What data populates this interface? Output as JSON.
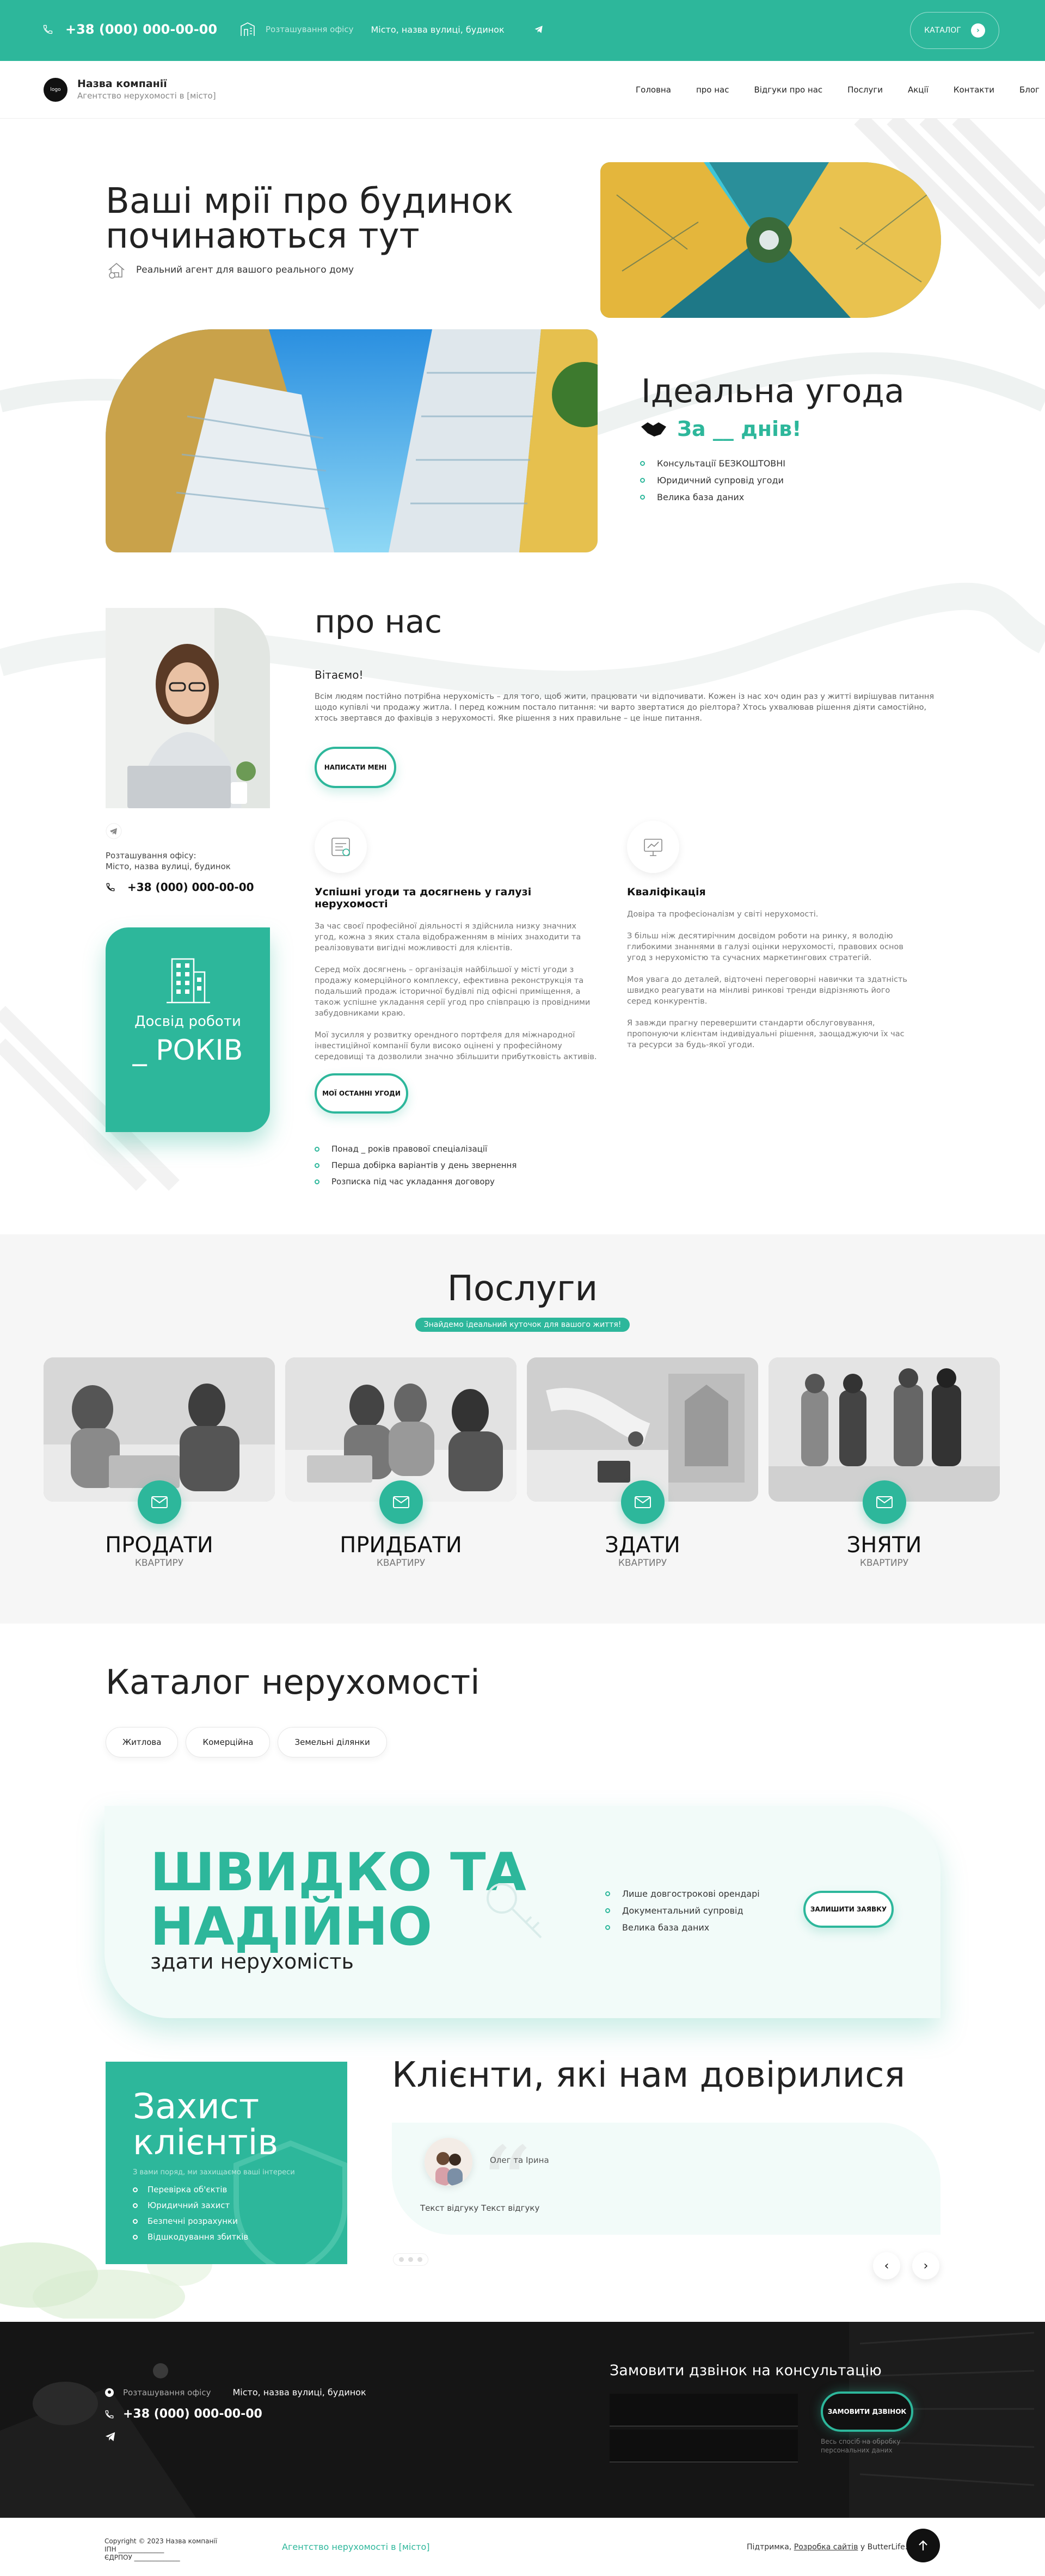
{
  "topbar": {
    "phone": "+38 (000) 000-00-00",
    "office_label": "Розташування офісу",
    "office_address": "Місто, назва вулиці, будинок",
    "catalog_label": "КАТАЛОГ"
  },
  "header": {
    "logo_text": "logo",
    "company_name": "Назва компанії",
    "company_sub": "Агентство нерухомості в [місто]",
    "nav": [
      "Головна",
      "про нас",
      "Відгуки про нас",
      "Послуги",
      "Акції",
      "Контакти",
      "Блог"
    ]
  },
  "hero": {
    "title_line1": "Ваші мрії про будинок",
    "title_line2": "починаються тут",
    "subtitle": "Реальний агент для вашого реального дому",
    "deal_title": "Ідеальна угода",
    "deal_days": "За __ днів!",
    "deal_points": [
      "Консультації БЕЗКОШТОВНІ",
      "Юридичний супровід угоди",
      "Велика база даних"
    ]
  },
  "about": {
    "title": "про нас",
    "greeting": "Вітаємо!",
    "text": "Всім людям постійно потрібна нерухомість – для того, щоб жити, працювати чи відпочивати. Кожен із нас хоч один раз у житті вирішував питання щодо купівлі чи продажу житла. І перед кожним постало питання: чи варто звертатися до ріелтора? Хтось ухвалював рішення діяти самостійно, хтось звертався до фахівців з нерухомості. Яке рішення з них правильне – це інше питання.",
    "write_btn": "НАПИСАТИ МЕНІ",
    "office_label": "Розташування офісу:",
    "office_address": "Місто, назва вулиці, будинок",
    "phone": "+38 (000) 000-00-00",
    "exp_label": "Досвід роботи",
    "exp_years": "_ РОКІВ",
    "feature1_title": "Успішні угоди та досягнень у галузі нерухомості",
    "feature1_p1": "За час своєї професійної діяльності я здійснила низку значних угод, кожна з яких стала відображенням в мініих знаходити та реалізовувати вигідні можливості для клієнтів.",
    "feature1_p2": "Серед моїх досягнень – організація найбільшої у місті угоди з продажу комерційного комплексу, ефективна реконструкція та подальший продаж історичної будівлі під офісні приміщення, а також успішне укладання серії угод про співпрацю із провідними забудовниками краю.",
    "feature1_p3": "Мої зусилля у розвитку орендного портфеля для міжнародної інвестиційної компанії були високо оцінені у професійному середовищі та дозволили значно збільшити прибутковість активів.",
    "feature2_title": "Кваліфікація",
    "feature2_p1": "Довіра та професіоналізм у світі нерухомості.",
    "feature2_p2": "З більш ніж десятирічним досвідом роботи на ринку, я володію глибокими знаннями в галузі оцінки нерухомості, правових основ угод з нерухомістю та сучасних маркетингових стратегій.",
    "feature2_p3": "Моя увага до деталей, відточені переговорні навички та здатність швидко реагувати на мінливі ринкові тренди відрізняють його серед конкурентів.",
    "feature2_p4": "Я завжди прагну перевершити стандарти обслуговування, пропонуючи клієнтам індивідуальні рішення, заощаджуючи їх час та ресурси за будь-якої угоди.",
    "achievements_btn": "МОЇ ОСТАННІ УГОДИ",
    "bullets": [
      "Понад _ років правової спеціалізації",
      "Перша добірка варіантів у день звернення",
      "Розписка під час укладання договору"
    ]
  },
  "services": {
    "title": "Послуги",
    "badge": "Знайдемо ідеальний куточок для вашого життя!",
    "items": [
      {
        "name": "ПРОДАТИ",
        "sub": "КВАРТИРУ"
      },
      {
        "name": "ПРИДБАТИ",
        "sub": "КВАРТИРУ"
      },
      {
        "name": "ЗДАТИ",
        "sub": "КВАРТИРУ"
      },
      {
        "name": "ЗНЯТИ",
        "sub": "КВАРТИРУ"
      }
    ]
  },
  "catalog": {
    "title": "Каталог нерухомості",
    "tabs": [
      "Житлова",
      "Комерційна",
      "Земельні ділянки"
    ]
  },
  "promo": {
    "headline_line1": "ШВИДКО ТА",
    "headline_line2": "НАДІЙНО",
    "sub": "здати нерухомість",
    "points": [
      "Лише довгострокові орендарі",
      "Документальний супровід",
      "Велика база даних"
    ],
    "cta": "ЗАЛИШИТИ ЗАЯВКУ"
  },
  "protection": {
    "title_line1": "Захист",
    "title_line2": "клієнтів",
    "sub": "З вами поряд, ми захищаємо ваші інтереси",
    "points": [
      "Перевірка об'єктів",
      "Юридичний захист",
      "Безпечні розрахунки",
      "Відшкодування збитків"
    ]
  },
  "clients": {
    "title": "Клієнти, які нам довірилися",
    "review_name": "Олег та Ірина",
    "review_text": "Текст відгуку Текст відгуку"
  },
  "footer": {
    "office_label": "Розташування офісу",
    "office_address": "Місто, назва вулиці, будинок",
    "phone": "+38 (000) 000-00-00",
    "consult_title": "Замовити дзвінок на консультацію",
    "call_btn": "ЗАМОВИТИ ДЗВІНОК",
    "note": "Весь спосіб на обробку персональних даних",
    "copyright": "Copyright © 2023 Назва компанії",
    "ipn": "ІПН ______________",
    "edrpou": "ЄДРПОУ ______________",
    "agency": "Агентство нерухомості в [місто]",
    "support_prefix": "Підтримка,",
    "support_link": "Розробка сайтів",
    "support_suffix": "у ButterLife."
  },
  "colors": {
    "accent": "#2db79b",
    "dark": "#121212"
  }
}
